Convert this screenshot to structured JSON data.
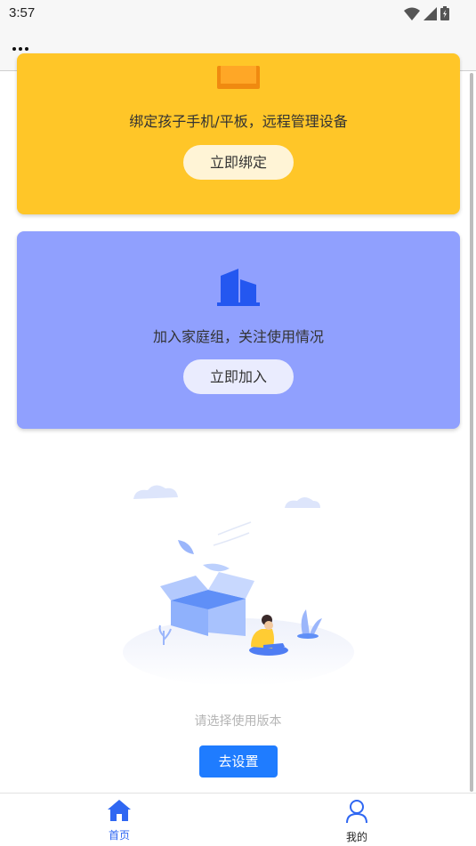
{
  "status_bar": {
    "time": "3:57"
  },
  "cards": [
    {
      "text": "绑定孩子手机/平板，远程管理设备",
      "button": "立即绑定",
      "color": "#ffc628"
    },
    {
      "text": "加入家庭组，关注使用情况",
      "button": "立即加入",
      "color": "#90a0fe"
    }
  ],
  "empty_state": {
    "message": "请选择使用版本",
    "button": "去设置"
  },
  "bottom_nav": {
    "items": [
      {
        "label": "首页",
        "icon": "home-icon",
        "active": true
      },
      {
        "label": "我的",
        "icon": "user-icon",
        "active": false
      }
    ]
  },
  "colors": {
    "accent": "#1f7cff",
    "nav_active": "#2f67f2"
  }
}
